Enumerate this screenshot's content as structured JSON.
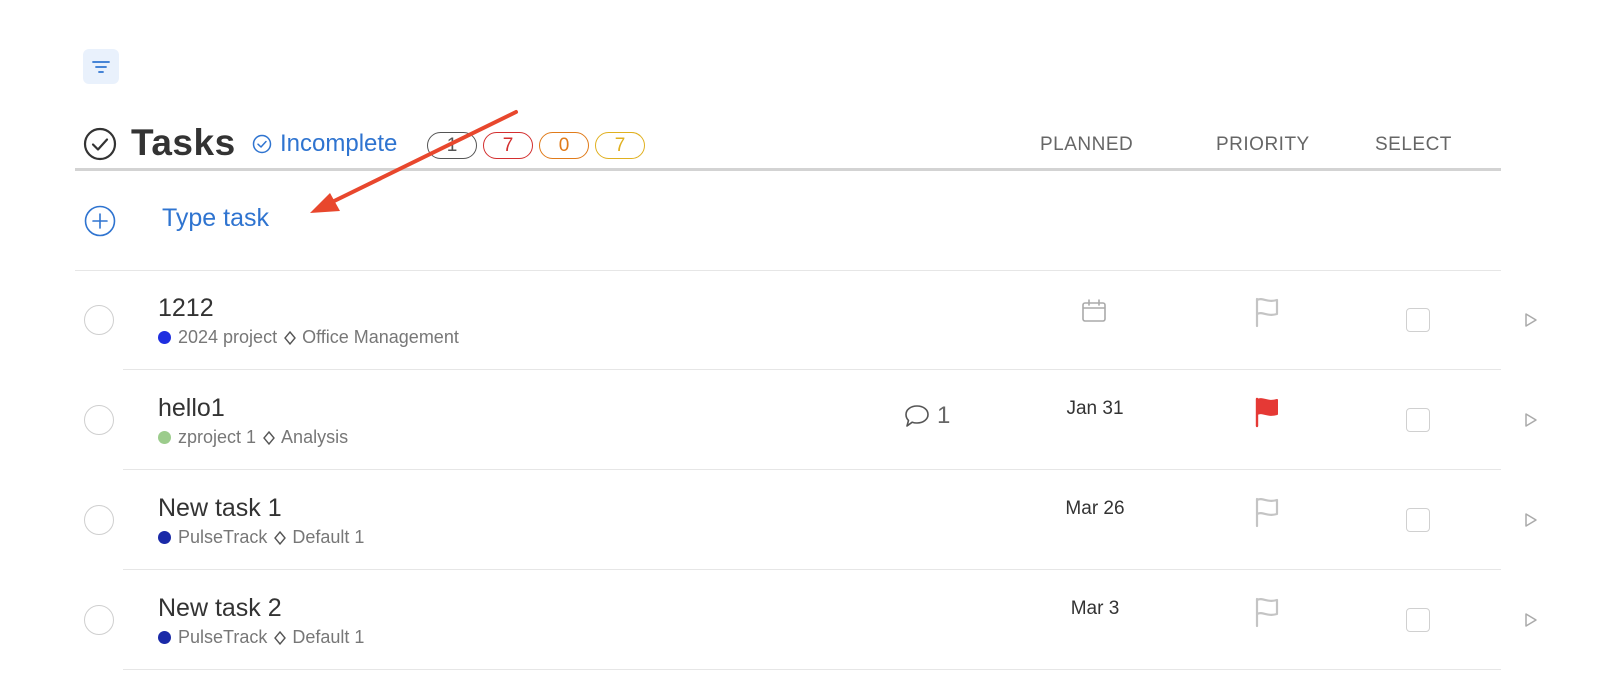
{
  "header": {
    "title": "Tasks",
    "filter_label": "Incomplete",
    "badges": [
      {
        "value": "1",
        "color": "#555555"
      },
      {
        "value": "7",
        "color": "#d32f2f"
      },
      {
        "value": "0",
        "color": "#e07b1a"
      },
      {
        "value": "7",
        "color": "#e0b020"
      }
    ],
    "columns": {
      "planned": "PLANNED",
      "priority": "PRIORITY",
      "select": "SELECT"
    }
  },
  "add_task": {
    "placeholder": "Type task"
  },
  "tasks": [
    {
      "title": "1212",
      "project": "2024 project",
      "project_color": "#1f2fe0",
      "section": "Office Management",
      "comments": null,
      "planned": null,
      "planned_icon": "calendar-icon",
      "priority_flag": "flag-outline-icon"
    },
    {
      "title": "hello1",
      "project": "zproject 1",
      "project_color": "#9ccc8c",
      "section": "Analysis",
      "comments": "1",
      "planned": "Jan 31",
      "priority_flag": "flag-filled-red-icon"
    },
    {
      "title": "New task 1",
      "project": "PulseTrack",
      "project_color": "#1a2aa8",
      "section": "Default 1",
      "comments": null,
      "planned": "Mar 26",
      "priority_flag": "flag-outline-icon"
    },
    {
      "title": "New task 2",
      "project": "PulseTrack",
      "project_color": "#1a2aa8",
      "section": "Default 1",
      "comments": null,
      "planned": "Mar 3",
      "priority_flag": "flag-outline-icon"
    }
  ],
  "colors": {
    "accent": "#2f74d0",
    "priority_high": "#e53935",
    "annotation_arrow": "#e8472d"
  }
}
